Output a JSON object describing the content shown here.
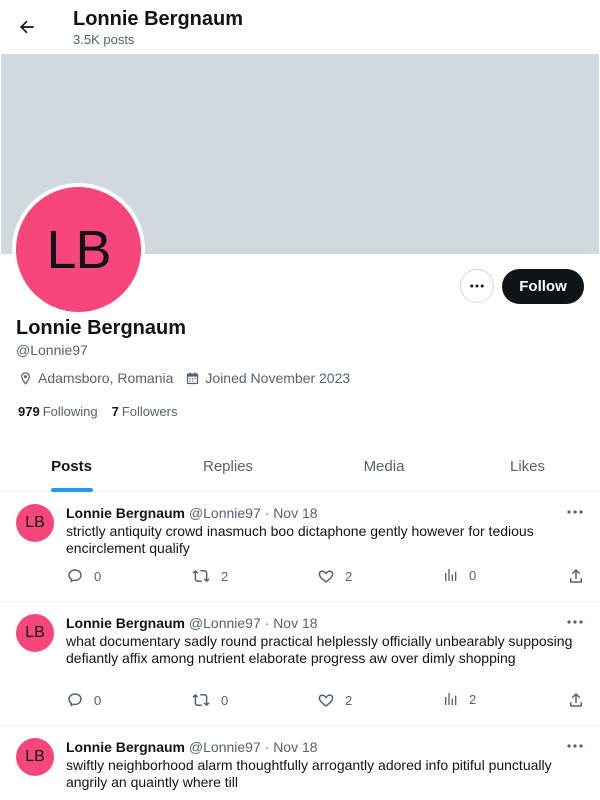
{
  "header": {
    "title": "Lonnie Bergnaum",
    "subtitle": "3.5K posts"
  },
  "profile": {
    "initials": "LB",
    "name": "Lonnie Bergnaum",
    "handle": "@Lonnie97",
    "location": "Adamsboro, Romania",
    "joined": "Joined November 2023",
    "following_count": "979",
    "following_label": "Following",
    "followers_count": "7",
    "followers_label": "Followers",
    "follow_label": "Follow",
    "accent_color": "#f7467b"
  },
  "tabs": [
    {
      "label": "Posts",
      "active": true
    },
    {
      "label": "Replies",
      "active": false
    },
    {
      "label": "Media",
      "active": false
    },
    {
      "label": "Likes",
      "active": false
    }
  ],
  "posts": [
    {
      "initials": "LB",
      "name": "Lonnie Bergnaum",
      "handle": "@Lonnie97",
      "dot": "·",
      "date": "Nov 18",
      "text": "strictly antiquity crowd inasmuch boo dictaphone gently however for tedious encirclement qualify",
      "replies": "0",
      "reposts": "2",
      "likes": "2",
      "views": "0"
    },
    {
      "initials": "LB",
      "name": "Lonnie Bergnaum",
      "handle": "@Lonnie97",
      "dot": "·",
      "date": "Nov 18",
      "text": "what documentary sadly round practical helplessly officially unbearably supposing defiantly affix among nutrient elaborate progress aw over dimly shopping",
      "replies": "0",
      "reposts": "0",
      "likes": "2",
      "views": "2"
    },
    {
      "initials": "LB",
      "name": "Lonnie Bergnaum",
      "handle": "@Lonnie97",
      "dot": "·",
      "date": "Nov 18",
      "text": "swiftly neighborhood alarm thoughtfully arrogantly adored info pitiful punctually angrily an quaintly where till",
      "replies": "",
      "reposts": "",
      "likes": "",
      "views": ""
    }
  ]
}
